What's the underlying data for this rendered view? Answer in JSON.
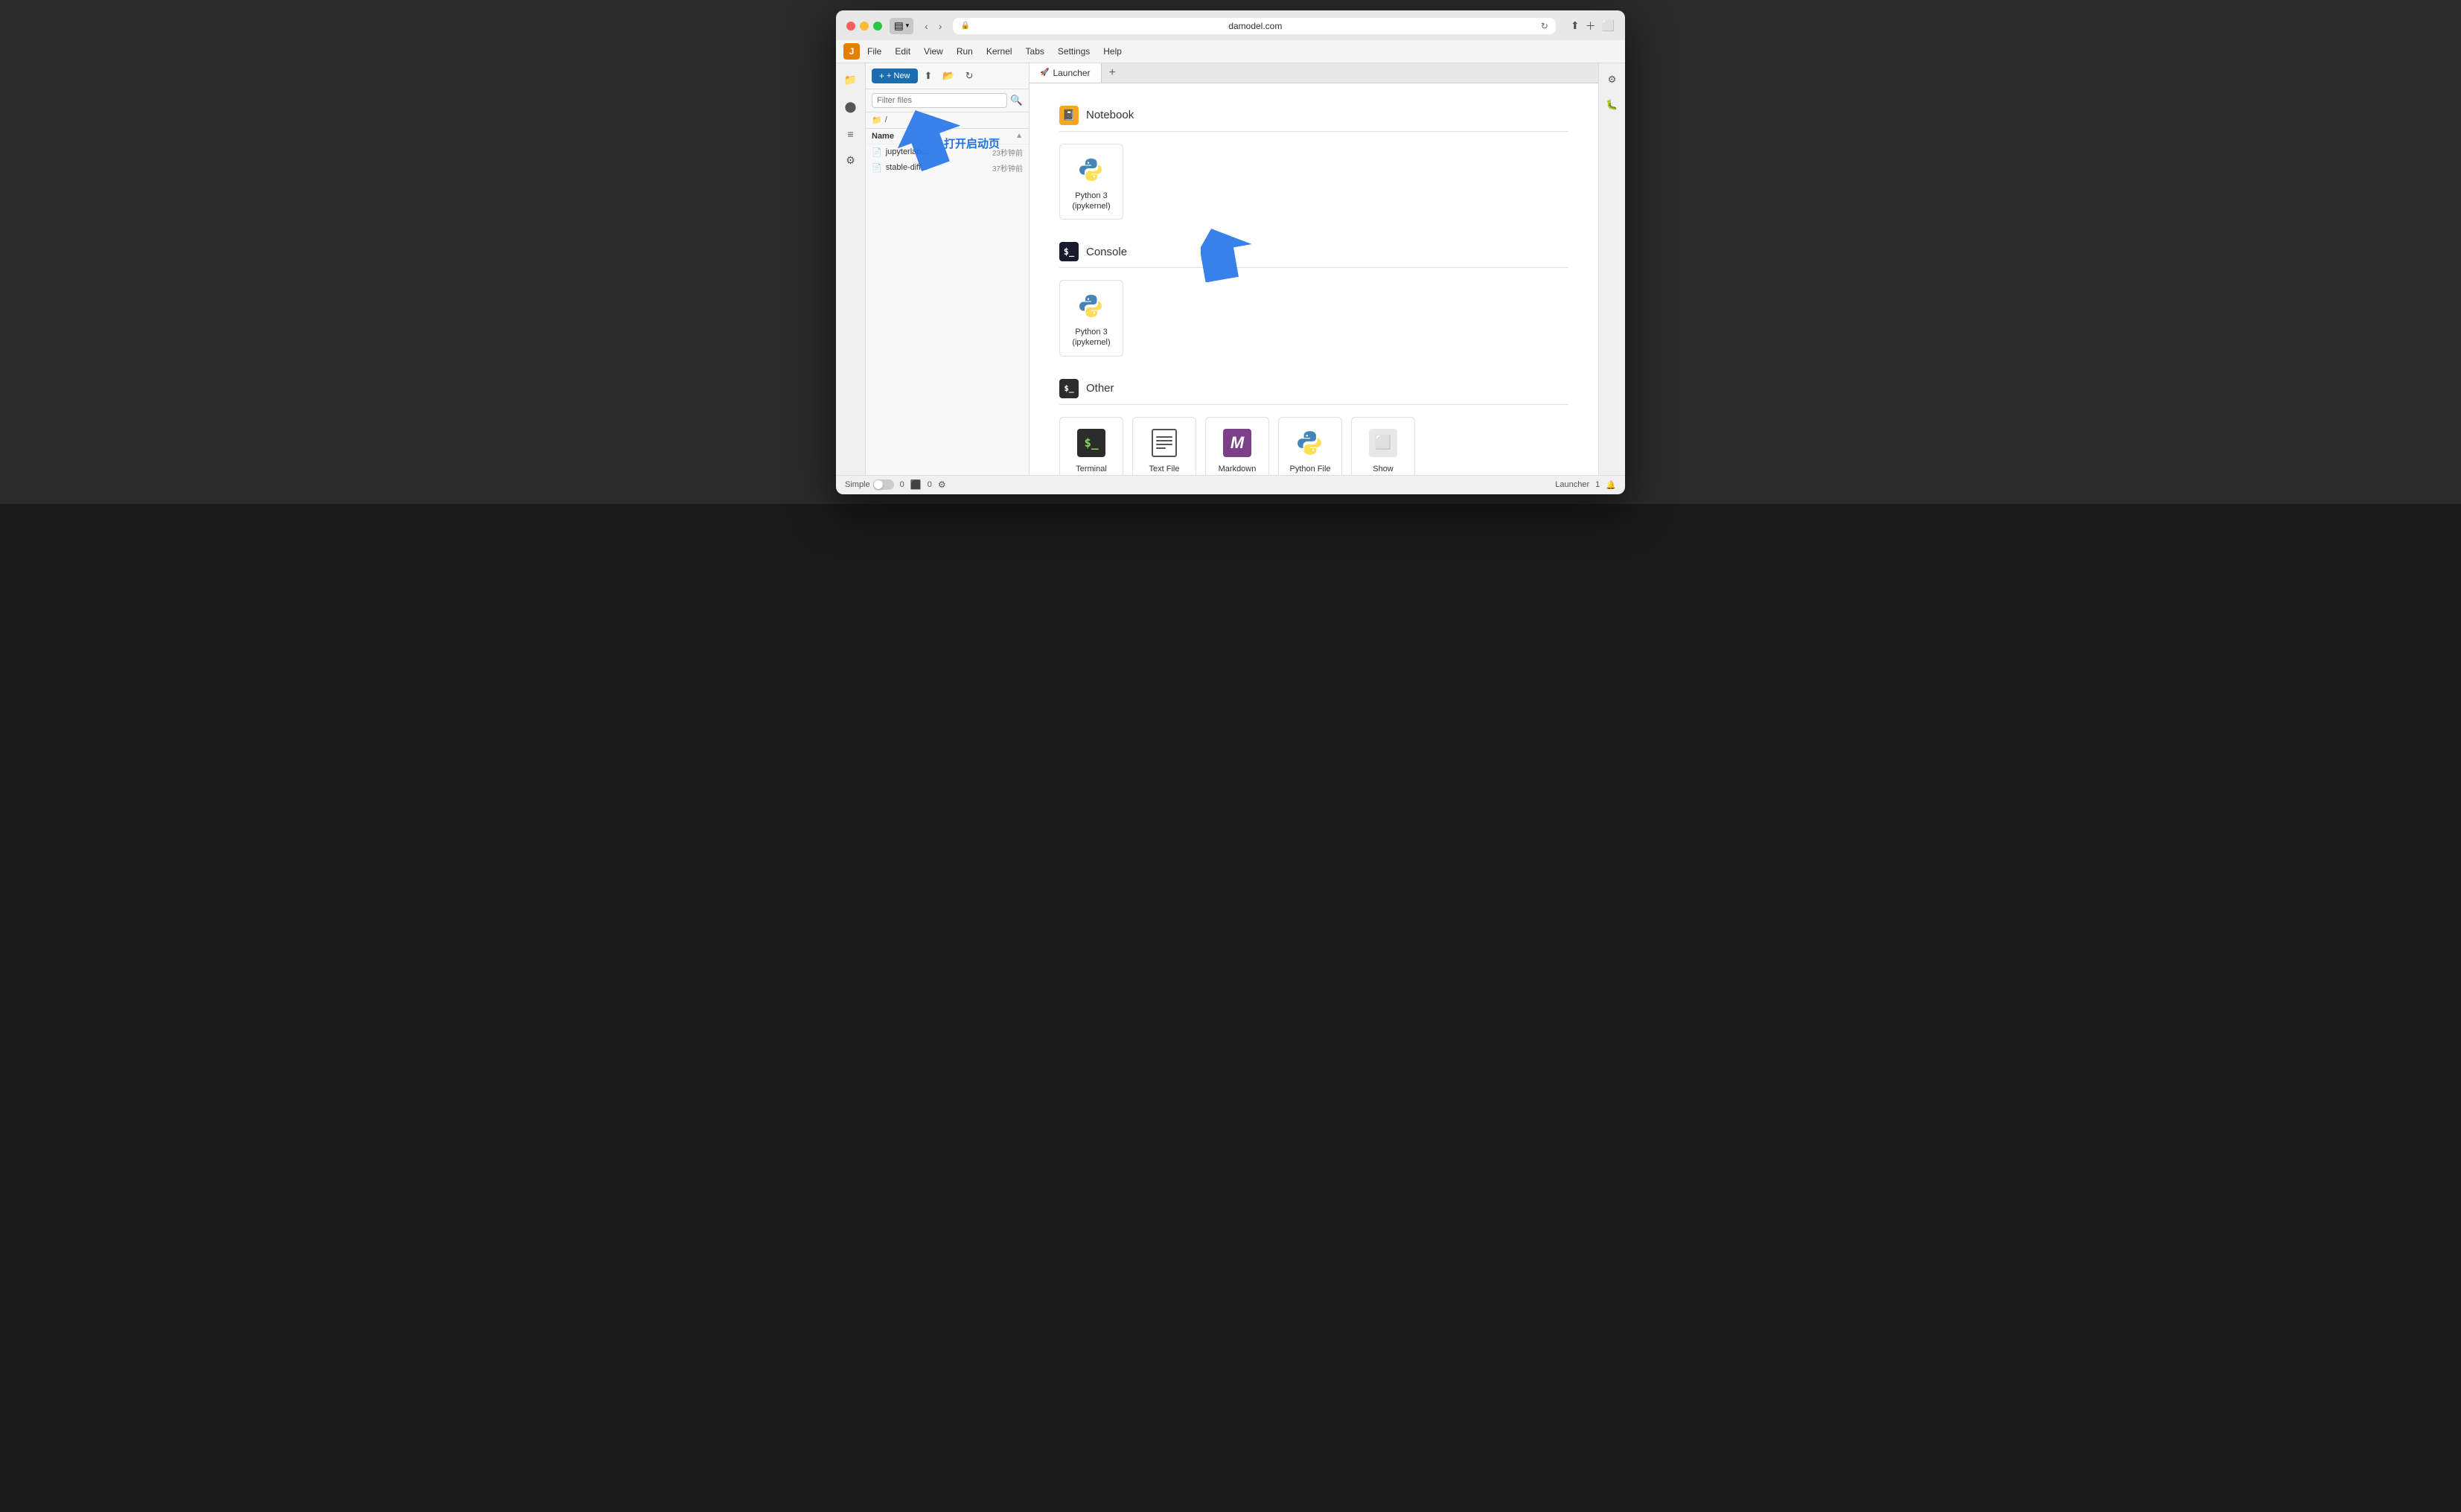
{
  "browser": {
    "url": "damodel.com",
    "tab_label": "Launcher",
    "tab_icon": "🚀"
  },
  "menubar": {
    "items": [
      "File",
      "Edit",
      "View",
      "Run",
      "Kernel",
      "Tabs",
      "Settings",
      "Help"
    ]
  },
  "sidebar": {
    "new_button": "+ New",
    "search_placeholder": "Filter files",
    "path": "/",
    "col_name": "Name",
    "files": [
      {
        "name": "jupyterlab....",
        "time": "23秒钟前"
      },
      {
        "name": "stable-diff...",
        "time": "37秒钟前"
      }
    ]
  },
  "launcher": {
    "sections": [
      {
        "id": "notebook",
        "title": "Notebook",
        "cards": [
          {
            "label": "Python 3\n(ipykernel)"
          }
        ]
      },
      {
        "id": "console",
        "title": "Console",
        "cards": [
          {
            "label": "Python 3\n(ipykernel)"
          }
        ]
      },
      {
        "id": "other",
        "title": "Other",
        "cards": [
          {
            "label": "Terminal"
          },
          {
            "label": "Text File"
          },
          {
            "label": "Markdown File"
          },
          {
            "label": "Python File"
          },
          {
            "label": "Show\nContextual Help"
          }
        ]
      }
    ]
  },
  "annotation": {
    "text": "打开启动页"
  },
  "statusbar": {
    "simple_label": "Simple",
    "kernel_count": "0",
    "terminal_count": "0",
    "launcher_label": "Launcher",
    "launcher_count": "1"
  }
}
